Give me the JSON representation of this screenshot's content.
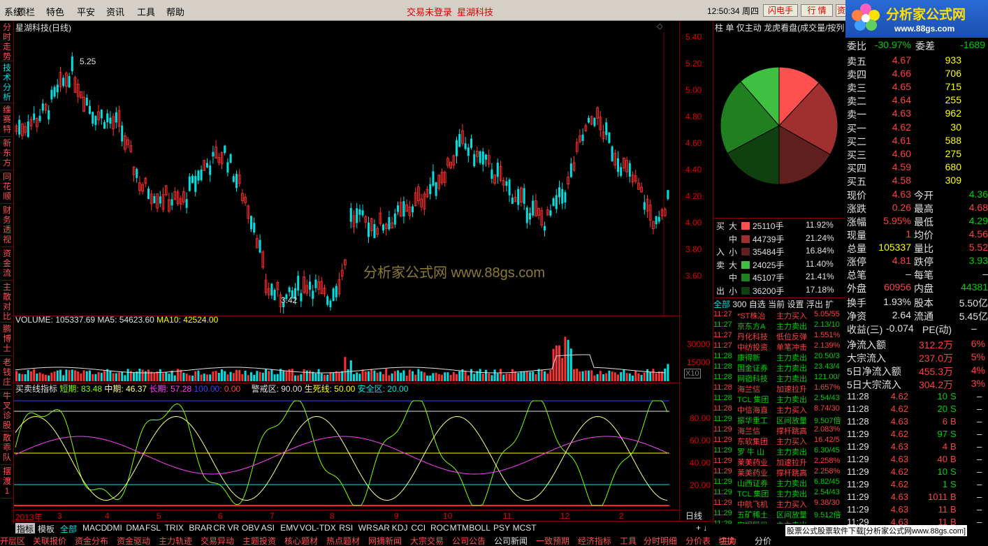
{
  "menubar": {
    "items": [
      "系统",
      "顶栏",
      "特色",
      "平安",
      "资讯",
      "工具",
      "帮助"
    ],
    "status1": "交易未登录",
    "status2": "星湖科技",
    "time": "12:50:34 周四",
    "btn_flash": "闪电手",
    "btn_quote": "行 情",
    "btn_more": "资"
  },
  "logo": {
    "title": "分析家公式网",
    "url": "www.88gs.com"
  },
  "left_tabs": [
    "分时走势",
    "技术分析",
    "维赛特",
    "新东方",
    "同花顺",
    "财务透视",
    "资金流",
    "主散对比",
    "鹏博士",
    "老钱庄",
    "牛叉诊股",
    "散乖队",
    "摆渡1"
  ],
  "chart": {
    "title": "星湖科技(日线)",
    "high_label": "5.25",
    "low_label": "3.42",
    "watermark": "分析家公式网 www.88gs.com",
    "price_ticks": [
      "5.40",
      "5.20",
      "5.00",
      "4.80",
      "4.60",
      "4.40",
      "4.20",
      "4.00",
      "3.80",
      "3.60"
    ],
    "volume_header": {
      "vol": "VOLUME: 105337.69",
      "ma5": "MA5: 54623.60",
      "ma10": "MA10: 42524.00"
    },
    "vol_ticks": [
      "30000",
      "15000"
    ],
    "vol_unit": "X10",
    "ind_header": {
      "name": "买卖线指标",
      "short": "短期: 83.48",
      "mid": "中期: 46.37",
      "long": "长期: 57.28",
      "v100": "100.00",
      "v0": ": 0.00",
      "warn": "警戒区: 90.00",
      "life": "生死线: 50.00",
      "safe": "安全区: 20.00"
    },
    "ind_ticks": [
      "80.00",
      "60.00",
      "40.00",
      "20.00"
    ],
    "x_labels": [
      "2013年",
      "3",
      "4",
      "5",
      "6",
      "7",
      "8",
      "9",
      "10",
      "11",
      "12",
      "2"
    ],
    "period": "日线"
  },
  "colors": {
    "up": "#ff3030",
    "down": "#00e0e0"
  },
  "right_panel": {
    "tabs": [
      "柱",
      "单",
      "仅主动",
      "龙虎看盘(成交量/按列"
    ],
    "flow": [
      {
        "side": "买",
        "size": "大",
        "val": "25110手",
        "pct": "11.92%",
        "color": "#ff5050"
      },
      {
        "side": "",
        "size": "中",
        "val": "44739手",
        "pct": "21.24%",
        "color": "#a03030"
      },
      {
        "side": "入",
        "size": "小",
        "val": "35484手",
        "pct": "16.84%",
        "color": "#602020"
      },
      {
        "side": "卖",
        "size": "大",
        "val": "24025手",
        "pct": "11.40%",
        "color": "#40c040"
      },
      {
        "side": "",
        "size": "中",
        "val": "45107手",
        "pct": "21.41%",
        "color": "#208020"
      },
      {
        "side": "出",
        "size": "小",
        "val": "36200手",
        "pct": "17.18%",
        "color": "#104010"
      }
    ],
    "filter_tabs": [
      "全部",
      "300",
      "自选",
      "当前",
      "设置",
      "浮出",
      "扩"
    ],
    "events": [
      [
        "11:27",
        "*ST株冶",
        "主力买入",
        "5.05/55"
      ],
      [
        "11:27",
        "京东方A",
        "主力卖出",
        "2.13/10"
      ],
      [
        "11:27",
        "丹化科技",
        "低位反弹",
        "1.551%"
      ],
      [
        "11:27",
        "中纺投资",
        "单笔冲击",
        "2.139%"
      ],
      [
        "11:28",
        "康得新",
        "主力卖出",
        "20.50/3"
      ],
      [
        "11:28",
        "国金证券",
        "主力卖出",
        "23.43/4"
      ],
      [
        "11:28",
        "网宿科技",
        "主力卖出",
        "121.00/"
      ],
      [
        "11:28",
        "海兰信",
        "加速拉升",
        "1.657%"
      ],
      [
        "11:28",
        "TCL 集团",
        "主力卖出",
        "2.54/43"
      ],
      [
        "11:28",
        "中信海直",
        "主力买入",
        "8.74/30"
      ],
      [
        "11:29",
        "振华重工",
        "区间放量",
        "9.507倍"
      ],
      [
        "11:29",
        "海兰信",
        "撑杆跳高",
        "2.083%"
      ],
      [
        "11:29",
        "东软集团",
        "主力买入",
        "16.42/5"
      ],
      [
        "11:29",
        "罗 牛 山",
        "主力卖出",
        "6.30/45"
      ],
      [
        "11:29",
        "莱美药业",
        "加速拉升",
        "2.258%"
      ],
      [
        "11:29",
        "莱美药业",
        "撑杆跳高",
        "2.258%"
      ],
      [
        "11:29",
        "山西证券",
        "主力卖出",
        "6.82/45"
      ],
      [
        "11:29",
        "TCL 集团",
        "主力卖出",
        "2.54/43"
      ],
      [
        "11:29",
        "中航飞机",
        "主力买入",
        "9.38/30"
      ],
      [
        "11:29",
        "五矿稀土",
        "区间放量",
        "9.512倍"
      ],
      [
        "11:29",
        "安妮股份",
        "主力卖出",
        ""
      ]
    ]
  },
  "quote": {
    "wb": {
      "l1": "委比",
      "v1": "-30.97%",
      "l2": "委差",
      "v2": "-1689"
    },
    "asks": [
      [
        "卖五",
        "4.67",
        "933"
      ],
      [
        "卖四",
        "4.66",
        "706"
      ],
      [
        "卖三",
        "4.65",
        "715"
      ],
      [
        "卖二",
        "4.64",
        "255"
      ],
      [
        "卖一",
        "4.63",
        "962"
      ]
    ],
    "bids": [
      [
        "买一",
        "4.62",
        "30"
      ],
      [
        "买二",
        "4.61",
        "588"
      ],
      [
        "买三",
        "4.60",
        "275"
      ],
      [
        "买四",
        "4.59",
        "680"
      ],
      [
        "买五",
        "4.58",
        "309"
      ]
    ],
    "stats": [
      [
        "现价",
        "4.63",
        "今开",
        "4.36"
      ],
      [
        "涨跌",
        "0.26",
        "最高",
        "4.68"
      ],
      [
        "涨幅",
        "5.95%",
        "最低",
        "4.29"
      ],
      [
        "现量",
        "1",
        "均价",
        "4.56"
      ],
      [
        "总量",
        "105337",
        "量比",
        "5.52"
      ],
      [
        "涨停",
        "4.81",
        "跌停",
        "3.93"
      ],
      [
        "总笔",
        "–",
        "每笔",
        "–"
      ],
      [
        "外盘",
        "60956",
        "内盘",
        "44381"
      ]
    ],
    "stats2": [
      [
        "换手",
        "1.93%",
        "股本",
        "5.50亿"
      ],
      [
        "净资",
        "2.64",
        "流通",
        "5.45亿"
      ]
    ],
    "eps": {
      "label": "收益(三)",
      "val": "-0.074",
      "pe": "PE(动)",
      "pev": "–"
    },
    "money": [
      [
        "净流入额",
        "312.2万",
        "6%"
      ],
      [
        "大宗流入",
        "237.0万",
        "5%"
      ],
      [
        "5日净流入额",
        "455.3万",
        "4%"
      ],
      [
        "5日大宗流入",
        "304.2万",
        "3%"
      ]
    ],
    "ticks": [
      [
        "11:28",
        "4.62",
        "10",
        "S"
      ],
      [
        "11:28",
        "4.62",
        "20",
        "S"
      ],
      [
        "11:28",
        "4.63",
        "6",
        "B"
      ],
      [
        "11:29",
        "4.62",
        "97",
        "S"
      ],
      [
        "11:29",
        "4.63",
        "4",
        "B"
      ],
      [
        "11:29",
        "4.63",
        "40",
        "B"
      ],
      [
        "11:29",
        "4.62",
        "10",
        "S"
      ],
      [
        "11:29",
        "4.62",
        "1",
        "S"
      ],
      [
        "11:29",
        "4.63",
        "1011",
        "B"
      ],
      [
        "11:29",
        "4.63",
        "11",
        "B"
      ],
      [
        "11:29",
        "4.63",
        "11",
        "B"
      ]
    ]
  },
  "bottom_tabs1": [
    "指标",
    "模板",
    "全部",
    "MACD",
    "DMI",
    "DMA",
    "FSL",
    "TRIX",
    "BRAR",
    "CR",
    "VR",
    "OBV",
    "ASI",
    "EMV",
    "VOL-TDX",
    "RSI",
    "WR",
    "SAR",
    "KDJ",
    "CCI",
    "ROC",
    "MTM",
    "BOLL",
    "PSY",
    "MCST"
  ],
  "bottom_tabs2": [
    "开层区",
    "关联报价",
    "资金分布",
    "资金驱动",
    "主力轨迹",
    "交易异动",
    "主题投资",
    "核心题材",
    "热点题材",
    "网摘新闻",
    "大宗交易",
    "公司公告",
    "公司新闻",
    "一致预期",
    "经济指标",
    "工具",
    "分时明细",
    "分价表",
    "切换"
  ],
  "footer_right": {
    "t1": "主力",
    "t2": "分价",
    "ad": "股票公式股票软件下载[分析家公式网www.88gs.com]"
  }
}
